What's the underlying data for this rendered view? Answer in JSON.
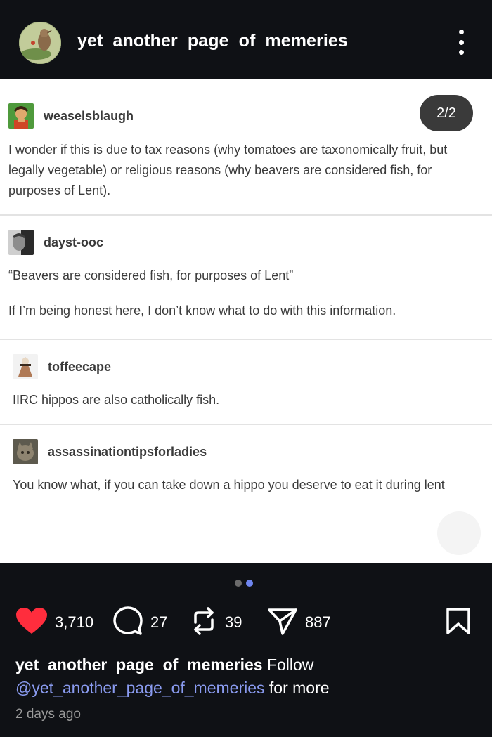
{
  "header": {
    "account_name": "yet_another_page_of_memeries"
  },
  "post": {
    "page_indicator": "2/2",
    "comments": [
      {
        "username": "weaselsblaugh",
        "text": "I wonder if this is due to tax reasons (why tomatoes are taxonomically fruit, but legally vegetable) or religious reasons (why beavers are considered fish, for purposes of Lent)."
      },
      {
        "username": "dayst-ooc",
        "quote": "“Beavers are considered fish, for purposes of Lent”",
        "text": "If I’m being honest here, I don’t know what to do with this information."
      },
      {
        "username": "toffeecape",
        "text": "IIRC hippos are also catholically fish."
      },
      {
        "username": "assassinationtipsforladies",
        "text": "You know what, if you can take down a hippo you deserve to eat it during lent"
      }
    ]
  },
  "carousel": {
    "total": 2,
    "active_index": 1
  },
  "actions": {
    "likes": "3,710",
    "comments": "27",
    "reposts": "39",
    "shares": "887"
  },
  "caption": {
    "account_name": "yet_another_page_of_memeries",
    "follow": "Follow",
    "mention": "@yet_another_page_of_memeries",
    "suffix": "for more"
  },
  "timestamp": "2 days ago",
  "colors": {
    "background": "#0f1115",
    "like": "#ff2d3d",
    "mention": "#8a9bf0",
    "dot_active": "#6f86f0",
    "dot_inactive": "#6b6b6b"
  }
}
